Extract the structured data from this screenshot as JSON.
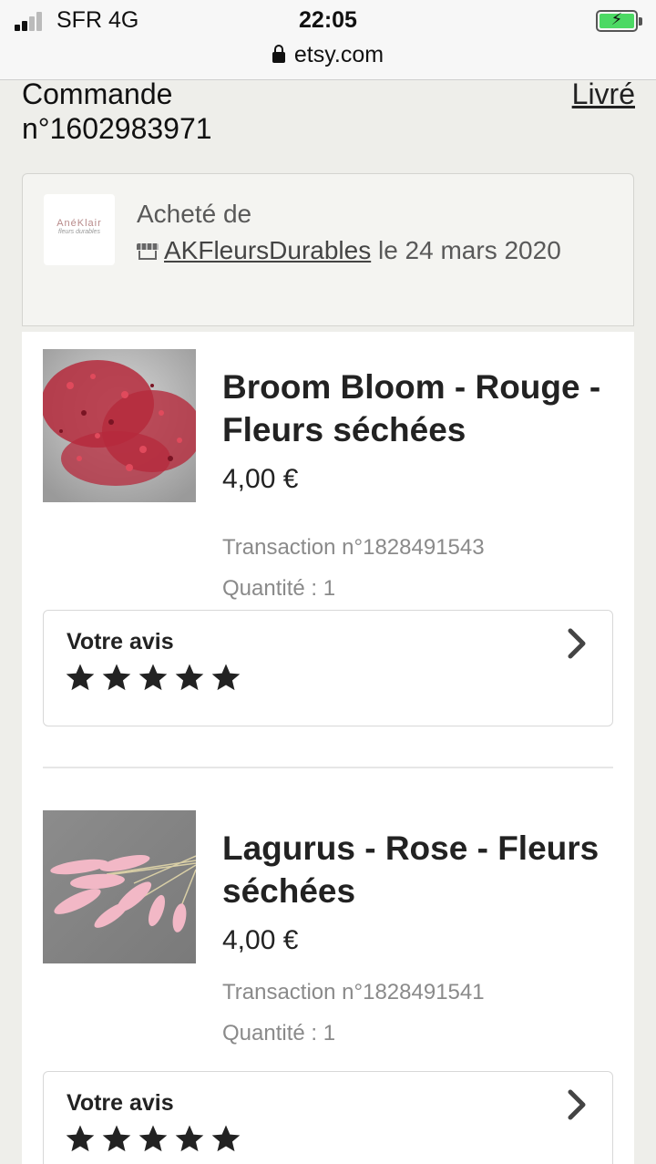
{
  "status_bar": {
    "carrier": "SFR   4G",
    "time": "22:05",
    "url": "etsy.com"
  },
  "order": {
    "title": "Commande n°1602983971",
    "status": "Livré"
  },
  "shop": {
    "bought_prefix": "Acheté de",
    "shop_name": "AKFleursDurables",
    "date": "le 24 mars 2020"
  },
  "items": [
    {
      "title": "Broom Bloom - Rouge - Fleurs séchées",
      "price": "4,00 €",
      "transaction": "Transaction n°1828491543",
      "quantity": "Quantité : 1",
      "review_label": "Votre avis",
      "rating": 5,
      "image_color": "#b52a3c"
    },
    {
      "title": "Lagurus - Rose - Fleurs séchées",
      "price": "4,00 €",
      "transaction": "Transaction n°1828491541",
      "quantity": "Quantité : 1",
      "review_label": "Votre avis",
      "rating": 5,
      "image_color": "#f2b8c6"
    }
  ]
}
